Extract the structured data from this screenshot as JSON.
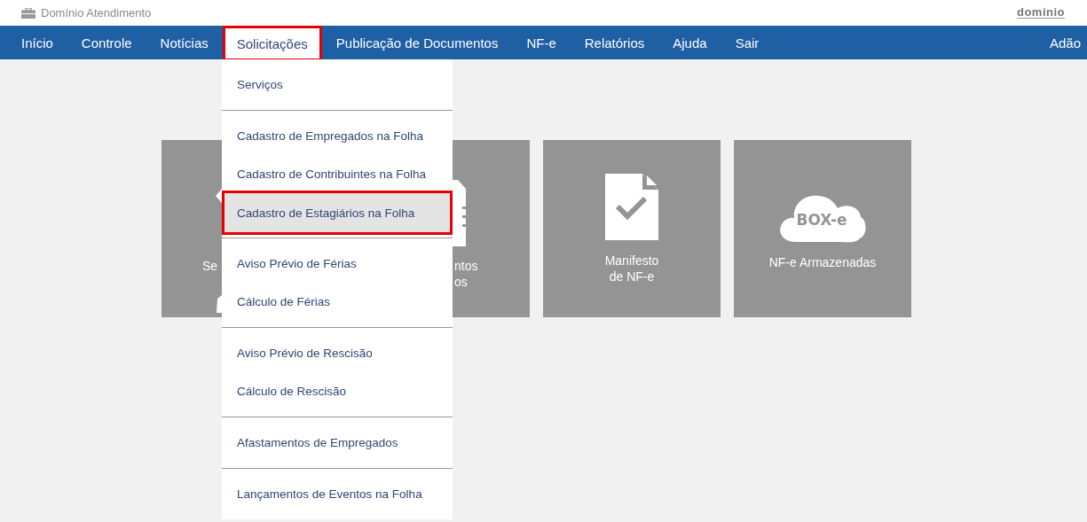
{
  "header": {
    "title": "Domínio Atendimento",
    "logo": "dominio"
  },
  "nav": {
    "items": [
      {
        "label": "Início",
        "selected": false
      },
      {
        "label": "Controle",
        "selected": false
      },
      {
        "label": "Notícias",
        "selected": false
      },
      {
        "label": "Solicitações",
        "selected": true
      },
      {
        "label": "Publicação de Documentos",
        "selected": false
      },
      {
        "label": "NF-e",
        "selected": false
      },
      {
        "label": "Relatórios",
        "selected": false
      },
      {
        "label": "Ajuda",
        "selected": false
      },
      {
        "label": "Sair",
        "selected": false
      }
    ],
    "user": "Adão"
  },
  "tiles": [
    {
      "kind": "cut-left",
      "lines": [
        "Se"
      ]
    },
    {
      "kind": "cut-right",
      "lines": [
        "ntos",
        "os"
      ]
    },
    {
      "kind": "document-check",
      "lines": [
        "Manifesto",
        "de NF-e"
      ]
    },
    {
      "kind": "cloud",
      "badge": "BOX-e",
      "lines": [
        "NF-e Armazenadas"
      ]
    }
  ],
  "menu": {
    "groups": [
      [
        {
          "label": "Serviços",
          "selected": false
        }
      ],
      [
        {
          "label": "Cadastro de Empregados na Folha",
          "selected": false
        },
        {
          "label": "Cadastro de Contribuintes na Folha",
          "selected": false
        },
        {
          "label": "Cadastro de Estagiários na Folha",
          "selected": true
        }
      ],
      [
        {
          "label": "Aviso Prévio de Férias",
          "selected": false
        },
        {
          "label": "Cálculo de Férias",
          "selected": false
        }
      ],
      [
        {
          "label": "Aviso Prévio de Rescisão",
          "selected": false
        },
        {
          "label": "Cálculo de Rescisão",
          "selected": false
        }
      ],
      [
        {
          "label": "Afastamentos de Empregados",
          "selected": false
        }
      ],
      [
        {
          "label": "Lançamentos de Eventos na Folha",
          "selected": false
        }
      ]
    ]
  }
}
